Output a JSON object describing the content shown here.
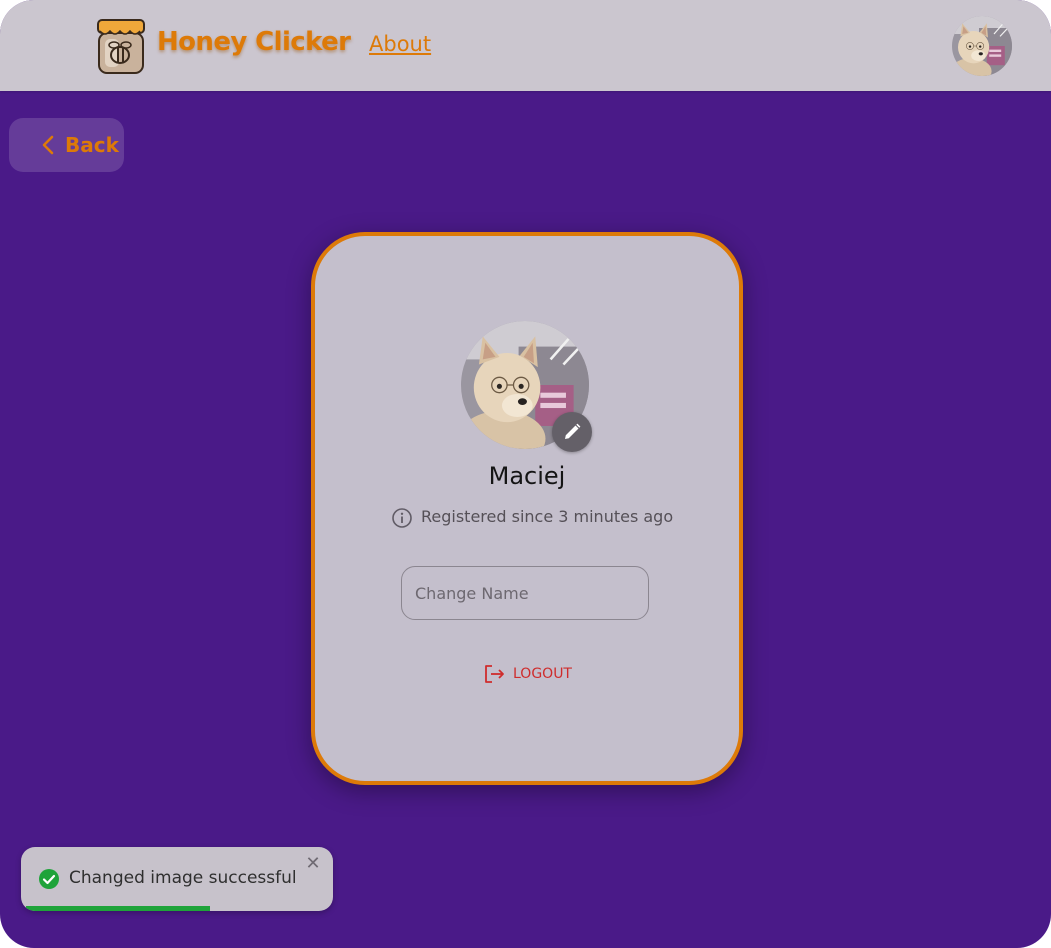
{
  "header": {
    "brand": "Honey Clicker",
    "nav_about": "About"
  },
  "back_button": {
    "label": "Back"
  },
  "profile": {
    "username": "Maciej",
    "registered_text": "Registered since 3 minutes ago",
    "name_input": {
      "placeholder": "Change Name",
      "value": ""
    },
    "logout_label": "LOGOUT"
  },
  "toast": {
    "message": "Changed image successful",
    "progress": 0.59
  },
  "icons": {
    "logo": "honey-jar-icon",
    "back": "chevron-left-icon",
    "edit": "pencil-icon",
    "info": "info-icon",
    "logout": "logout-icon",
    "success": "check-circle-icon",
    "close": "close-icon"
  },
  "colors": {
    "accent": "#dd7a08",
    "page_background": "#4a1a88",
    "header_background": "#cbc6cf",
    "card_background": "#c4bfcc",
    "logout": "#cf2c2c",
    "success": "#1fa33a"
  }
}
